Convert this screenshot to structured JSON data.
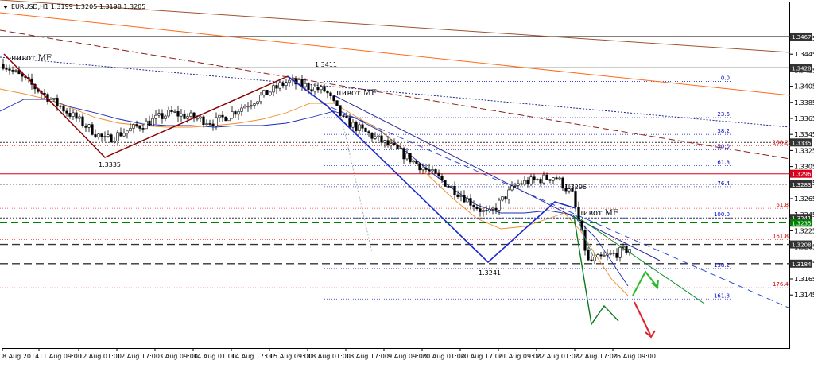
{
  "chart_data": {
    "type": "candlestick",
    "title": "EURUSD,H1  1.3199 1.3205 1.3198 1.3205",
    "ylim": [
      1.3148,
      1.3478
    ],
    "y_ticks": [
      "1.3465",
      "1.3445",
      "1.3425",
      "1.3405",
      "1.3385",
      "1.3365",
      "1.3345",
      "1.3325",
      "1.3305",
      "1.3285",
      "1.3265",
      "1.3245",
      "1.3225",
      "1.3205",
      "1.3185",
      "1.3165",
      "1.3145"
    ],
    "x_ticks": [
      "8 Aug 2014",
      "11 Aug 09:00",
      "12 Aug 01:00",
      "12 Aug 17:00",
      "13 Aug 09:00",
      "14 Aug 01:00",
      "14 Aug 17:00",
      "15 Aug 09:00",
      "18 Aug 01:00",
      "18 Aug 17:00",
      "19 Aug 09:00",
      "20 Aug 01:00",
      "20 Aug 17:00",
      "21 Aug 09:00",
      "22 Aug 01:00",
      "22 Aug 17:00",
      "25 Aug 09:00"
    ],
    "price_levels": [
      {
        "label": "1.3467",
        "value": 1.3467,
        "color": "#333333"
      },
      {
        "label": "1.3428",
        "value": 1.3428,
        "color": "#333333"
      },
      {
        "label": "1.3335",
        "value": 1.3335,
        "color": "#333333"
      },
      {
        "label": "1.3296",
        "value": 1.3296,
        "color": "#d9001b"
      },
      {
        "label": "1.3283",
        "value": 1.3283,
        "color": "#333333"
      },
      {
        "label": "1.3241",
        "value": 1.3241,
        "color": "#333333"
      },
      {
        "label": "1.3235",
        "value": 1.3235,
        "color": "#008000"
      },
      {
        "label": "1.3208",
        "value": 1.3208,
        "color": "#333333"
      },
      {
        "label": "1.3184",
        "value": 1.3184,
        "color": "#333333"
      }
    ],
    "fib_levels": [
      {
        "label": "0.0",
        "value": 1.3411
      },
      {
        "label": "23.6",
        "value": 1.3366
      },
      {
        "label": "38.2",
        "value": 1.3345
      },
      {
        "label": "50.0",
        "value": 1.3326
      },
      {
        "label": "61.8",
        "value": 1.3306
      },
      {
        "label": "76.4",
        "value": 1.328
      },
      {
        "label": "100.0",
        "value": 1.3241
      },
      {
        "label": "138.2",
        "value": 1.3178
      },
      {
        "label": "161.8",
        "value": 1.314
      }
    ],
    "red_fib_levels": [
      {
        "label": "138.2",
        "value": 1.3331
      },
      {
        "label": "61.8",
        "value": 1.3253
      },
      {
        "label": "161.8",
        "value": 1.3214
      },
      {
        "label": "176.4",
        "value": 1.3154
      }
    ],
    "swing_points": [
      {
        "label": "1.3335",
        "value": 1.3335
      },
      {
        "label": "1.3411",
        "value": 1.3411
      },
      {
        "label": "1.3296",
        "value": 1.3296
      },
      {
        "label": "1.3241",
        "value": 1.3241
      }
    ],
    "annotations": [
      "пивот MF",
      "пивот MF",
      "пивот MF"
    ]
  }
}
